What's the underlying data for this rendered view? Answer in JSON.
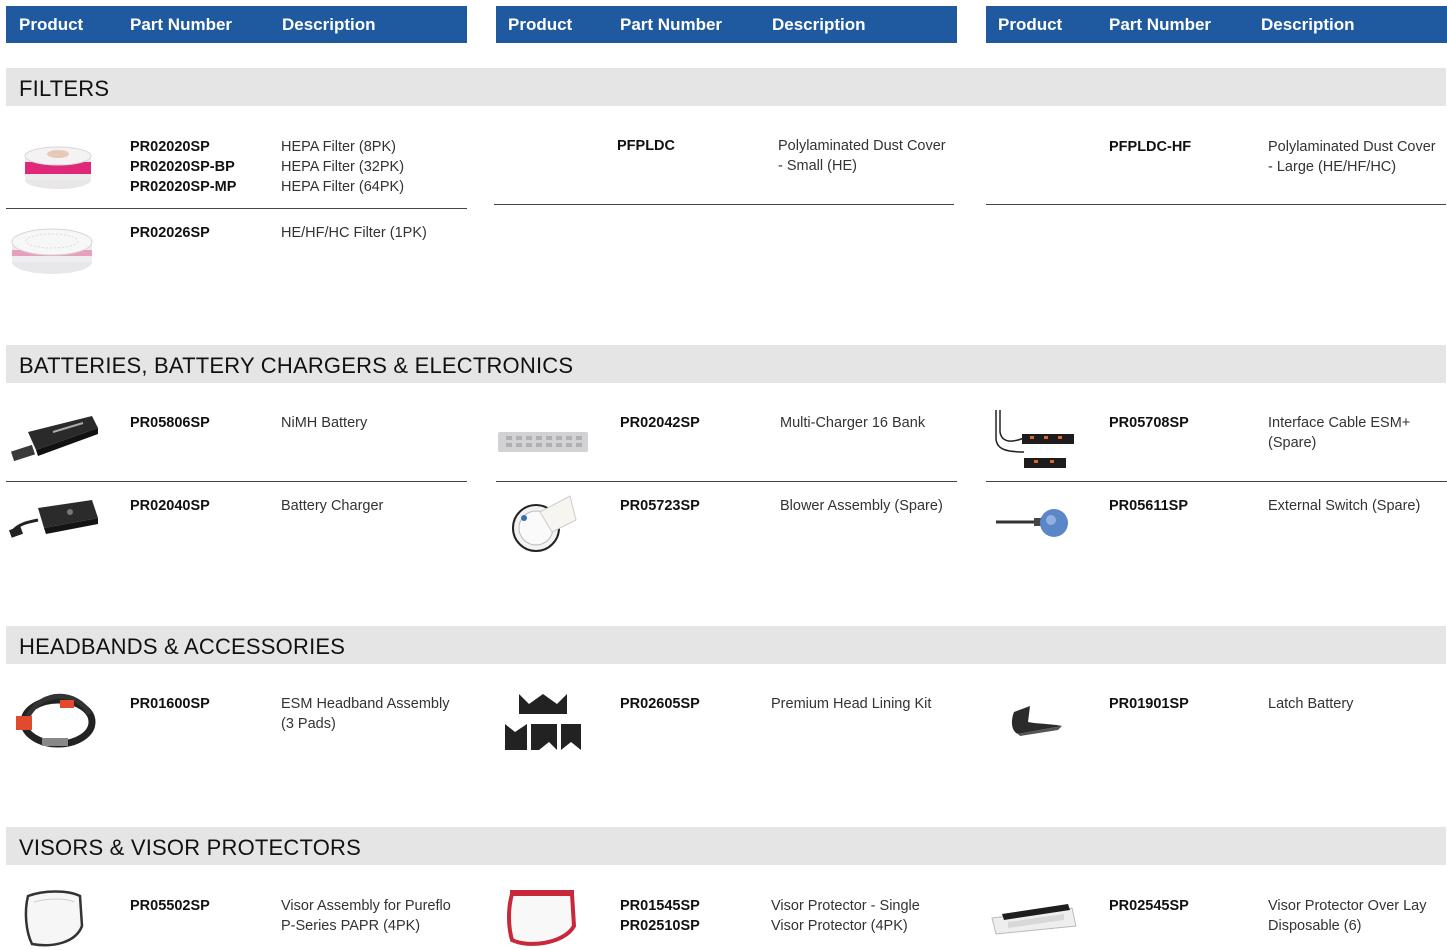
{
  "columns": [
    "Product",
    "Part Number",
    "Description"
  ],
  "sections": {
    "filters": "FILTERS",
    "batteries": "BATTERIES, BATTERY CHARGERS & ELECTRONICS",
    "headbands": "HEADBANDS & ACCESSORIES",
    "visors": "VISORS & VISOR PROTECTORS"
  },
  "items": {
    "f1": {
      "pn": [
        "PR02020SP",
        "PR02020SP-BP",
        "PR02020SP-MP"
      ],
      "desc": [
        "HEPA Filter (8PK)",
        "HEPA Filter (32PK)",
        "HEPA Filter (64PK)"
      ]
    },
    "f2": {
      "pn": [
        "PR02026SP"
      ],
      "desc": [
        "HE/HF/HC Filter (1PK)"
      ]
    },
    "f3": {
      "pn": [
        "PFPLDC"
      ],
      "desc": [
        "Polylaminated Dust Cover - Small (HE)"
      ]
    },
    "f4": {
      "pn": [
        "PFPLDC-HF"
      ],
      "desc": [
        "Polylaminated Dust Cover - Large (HE/HF/HC)"
      ]
    },
    "b1": {
      "pn": [
        "PR05806SP"
      ],
      "desc": [
        "NiMH Battery"
      ]
    },
    "b2": {
      "pn": [
        "PR02040SP"
      ],
      "desc": [
        "Battery Charger"
      ]
    },
    "b3": {
      "pn": [
        "PR02042SP"
      ],
      "desc": [
        "Multi-Charger 16 Bank"
      ]
    },
    "b4": {
      "pn": [
        "PR05723SP"
      ],
      "desc": [
        "Blower Assembly (Spare)"
      ]
    },
    "b5": {
      "pn": [
        "PR05708SP"
      ],
      "desc": [
        "Interface Cable ESM+ (Spare)"
      ]
    },
    "b6": {
      "pn": [
        "PR05611SP"
      ],
      "desc": [
        "External Switch (Spare)"
      ]
    },
    "h1": {
      "pn": [
        "PR01600SP"
      ],
      "desc": [
        "ESM Headband Assembly (3 Pads)"
      ]
    },
    "h2": {
      "pn": [
        "PR02605SP"
      ],
      "desc": [
        "Premium Head Lining Kit"
      ]
    },
    "h3": {
      "pn": [
        "PR01901SP"
      ],
      "desc": [
        "Latch Battery"
      ]
    },
    "v1": {
      "pn": [
        "PR05502SP"
      ],
      "desc": [
        "Visor Assembly for Pureflo P-Series PAPR (4PK)"
      ]
    },
    "v2": {
      "pn": [
        "PR01545SP",
        "PR02510SP"
      ],
      "desc": [
        "Visor Protector - Single",
        "Visor Protector (4PK)"
      ]
    },
    "v3": {
      "pn": [
        "PR02545SP"
      ],
      "desc": [
        "Visor Protector Over Lay Disposable (6)"
      ]
    }
  }
}
